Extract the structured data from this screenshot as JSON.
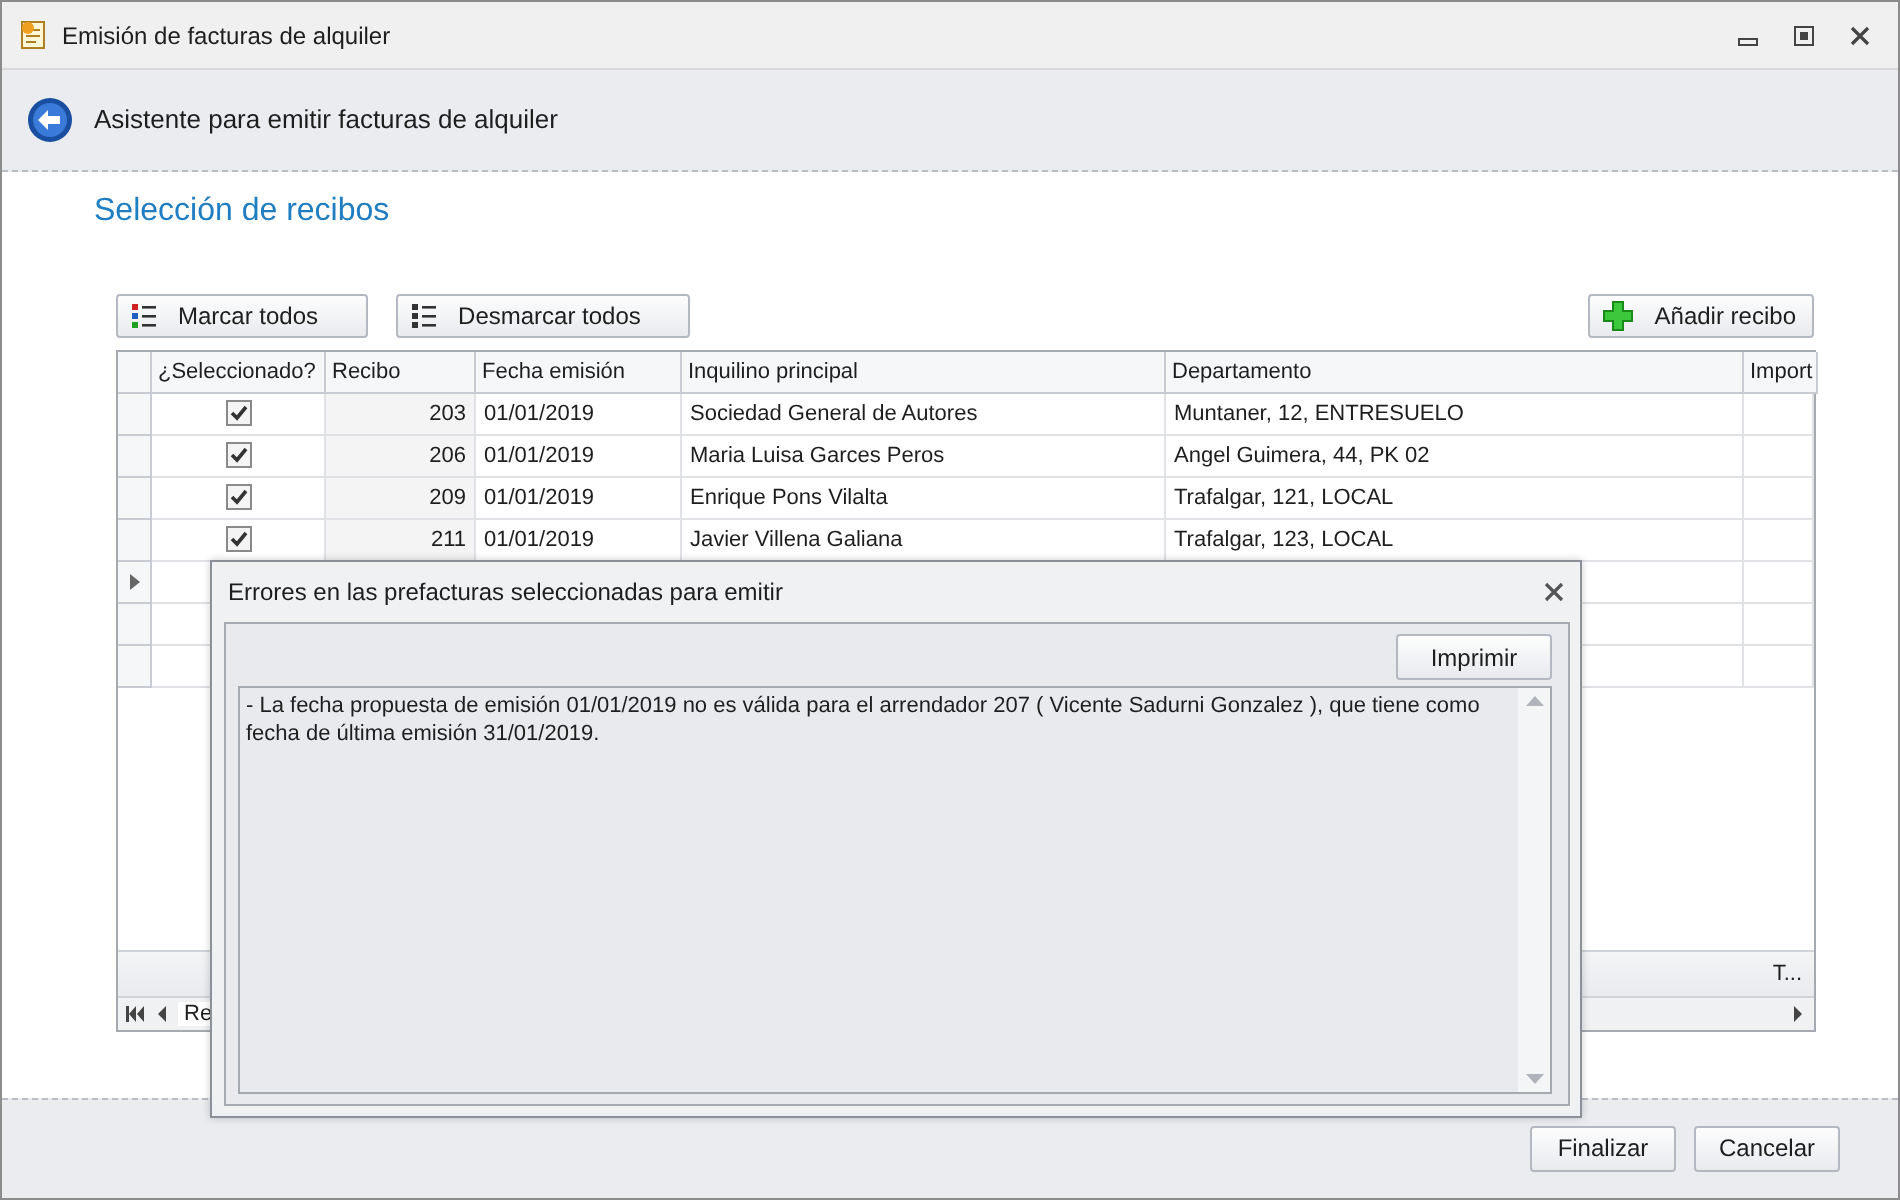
{
  "window": {
    "title": "Emisión de facturas de alquiler"
  },
  "wizard": {
    "title": "Asistente para emitir facturas de alquiler",
    "page_title": "Selección de recibos"
  },
  "toolbar": {
    "left_buttons": [
      {
        "label": "Marcar todos",
        "kind": "check-all"
      },
      {
        "label": "Desmarcar todos",
        "kind": "uncheck-all"
      }
    ],
    "add_button": "Añadir recibo"
  },
  "grid": {
    "columns": [
      "¿Seleccionado?",
      "Recibo",
      "Fecha emisión",
      "Inquilino principal",
      "Departamento",
      "Import"
    ],
    "rows": [
      {
        "checked": true,
        "recibo": "203",
        "fecha": "01/01/2019",
        "inquilino": "Sociedad General de Autores",
        "departamento": "Muntaner, 12, ENTRESUELO"
      },
      {
        "checked": true,
        "recibo": "206",
        "fecha": "01/01/2019",
        "inquilino": "Maria Luisa Garces Peros",
        "departamento": "Angel Guimera, 44, PK 02"
      },
      {
        "checked": true,
        "recibo": "209",
        "fecha": "01/01/2019",
        "inquilino": "Enrique Pons Vilalta",
        "departamento": "Trafalgar, 121, LOCAL"
      },
      {
        "checked": true,
        "recibo": "211",
        "fecha": "01/01/2019",
        "inquilino": "Javier Villena Galiana",
        "departamento": "Trafalgar, 123, LOCAL"
      }
    ],
    "new_row_current": true,
    "footer_text": "T...",
    "navigator_text": "Re"
  },
  "dialog": {
    "title": "Errores en las prefacturas seleccionadas para emitir",
    "print_button": "Imprimir",
    "message": "- La fecha propuesta de emisión 01/01/2019 no es válida para el arrendador 207 ( Vicente Sadurni Gonzalez ), que tiene como fecha de última emisión 31/01/2019."
  },
  "footer": {
    "buttons": [
      "Finalizar",
      "Cancelar"
    ]
  }
}
